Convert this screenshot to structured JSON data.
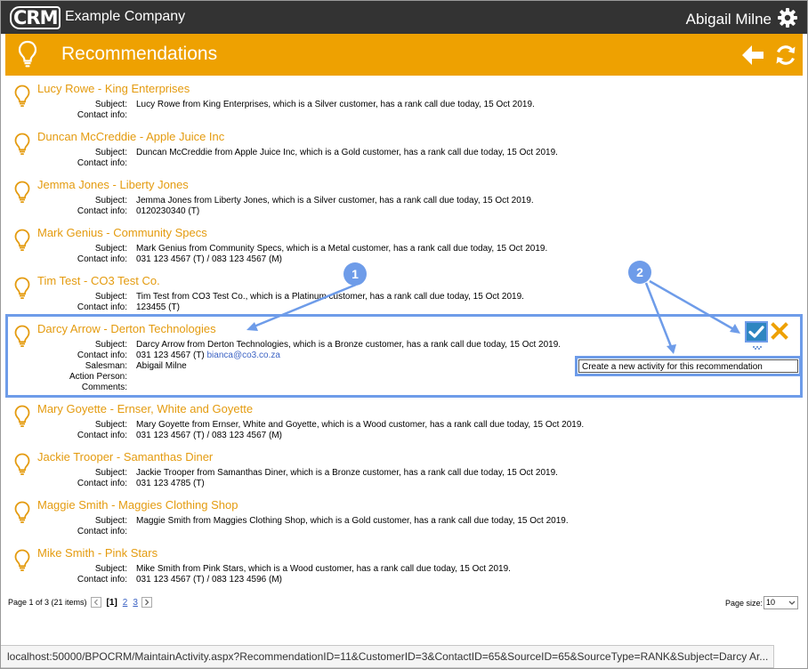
{
  "header": {
    "logo_text": "CRM",
    "company": "Example Company",
    "user": "Abigail Milne"
  },
  "titlebar": {
    "title": "Recommendations"
  },
  "labels": {
    "subject": "Subject:",
    "contact": "Contact info:",
    "salesman": "Salesman:",
    "action_person": "Action Person:",
    "comments": "Comments:"
  },
  "recommendations": [
    {
      "title": "Lucy Rowe - King Enterprises",
      "subject": "Lucy Rowe from King Enterprises, which is a Silver customer, has a rank call due today, 15 Oct 2019.",
      "contact": ""
    },
    {
      "title": "Duncan McCreddie - Apple Juice Inc",
      "subject": "Duncan McCreddie from Apple Juice Inc, which is a Gold customer, has a rank call due today, 15 Oct 2019.",
      "contact": ""
    },
    {
      "title": "Jemma Jones - Liberty Jones",
      "subject": "Jemma Jones from Liberty Jones, which is a Silver customer, has a rank call due today, 15 Oct 2019.",
      "contact": "0120230340 (T)"
    },
    {
      "title": "Mark Genius - Community Specs",
      "subject": "Mark Genius from Community Specs, which is a Metal customer, has a rank call due today, 15 Oct 2019.",
      "contact": "031 123 4567 (T) / 083 123 4567 (M)"
    },
    {
      "title": "Tim Test - CO3 Test Co.",
      "subject": "Tim Test from CO3 Test Co., which is a Platinum customer, has a rank call due today, 15 Oct 2019.",
      "contact": "123455 (T)"
    },
    {
      "title": "Darcy Arrow - Derton Technologies",
      "subject": "Darcy Arrow from Derton Technologies, which is a Bronze customer, has a rank call due today, 15 Oct 2019.",
      "contact": "031 123 4567 (T)",
      "email": "bianca@co3.co.za",
      "salesman": "Abigail Milne",
      "action_person": "",
      "comments": ""
    },
    {
      "title": "Mary Goyette - Ernser, White and Goyette",
      "subject": "Mary Goyette from Ernser, White and Goyette, which is a Wood customer, has a rank call due today, 15 Oct 2019.",
      "contact": "031 123 4567 (T) / 083 123 4567 (M)"
    },
    {
      "title": "Jackie Trooper - Samanthas Diner",
      "subject": "Jackie Trooper from Samanthas Diner, which is a Bronze customer, has a rank call due today, 15 Oct 2019.",
      "contact": "031 123 4785 (T)"
    },
    {
      "title": "Maggie Smith - Maggies Clothing Shop",
      "subject": "Maggie Smith from Maggies Clothing Shop, which is a Gold customer, has a rank call due today, 15 Oct 2019.",
      "contact": ""
    },
    {
      "title": "Mike Smith - Pink Stars",
      "subject": "Mike Smith from Pink Stars, which is a Wood customer, has a rank call due today, 15 Oct 2019.",
      "contact": "031 123 4567 (T) / 083 123 4596 (M)"
    }
  ],
  "tooltip": "Create a new activity for this recommendation",
  "callouts": [
    "1",
    "2"
  ],
  "pager": {
    "summary": "Page 1 of 3 (21 items)",
    "current": "[1]",
    "page2": "2",
    "page3": "3",
    "size_label": "Page size:",
    "size_value": "10"
  },
  "status_url": "localhost:50000/BPOCRM/MaintainActivity.aspx?RecommendationID=11&CustomerID=3&ContactID=65&SourceID=65&SourceType=RANK&Subject=Darcy Ar...",
  "colors": {
    "accent_orange": "#eea101",
    "title_orange": "#e49b0f",
    "topbar": "#333333",
    "annotation_blue": "#6e9ce9",
    "link_blue": "#3c63c4"
  }
}
